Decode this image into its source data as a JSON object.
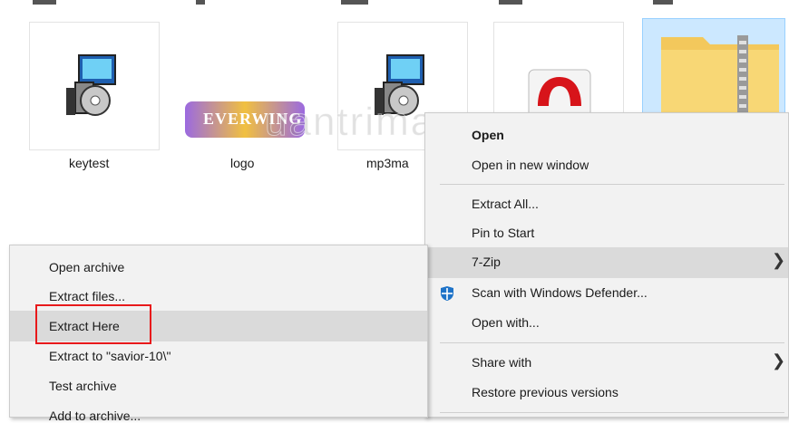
{
  "files": [
    {
      "name": "keytest"
    },
    {
      "name": "logo",
      "logo_text": "EVERWING"
    },
    {
      "name": "mp3ma"
    },
    {
      "name": ""
    },
    {
      "name": ""
    }
  ],
  "watermark": "uantrimang",
  "context_menu": {
    "items": [
      "Open",
      "Open in new window",
      "Extract All...",
      "Pin to Start",
      "7-Zip",
      "Scan with Windows Defender...",
      "Open with...",
      "Share with",
      "Restore previous versions"
    ]
  },
  "submenu_7zip": {
    "items": [
      "Open archive",
      "Extract files...",
      "Extract Here",
      "Extract to \"savior-10\\\"",
      "Test archive",
      "Add to archive..."
    ]
  },
  "colors": {
    "selection": "#cce8ff",
    "highlight": "#dadada",
    "annotation": "#e8191b",
    "defender": "#1e73c8"
  },
  "icons": [
    "installer-icon",
    "opera-icon",
    "zip-folder-icon",
    "defender-shield-icon",
    "chevron-right-icon"
  ]
}
